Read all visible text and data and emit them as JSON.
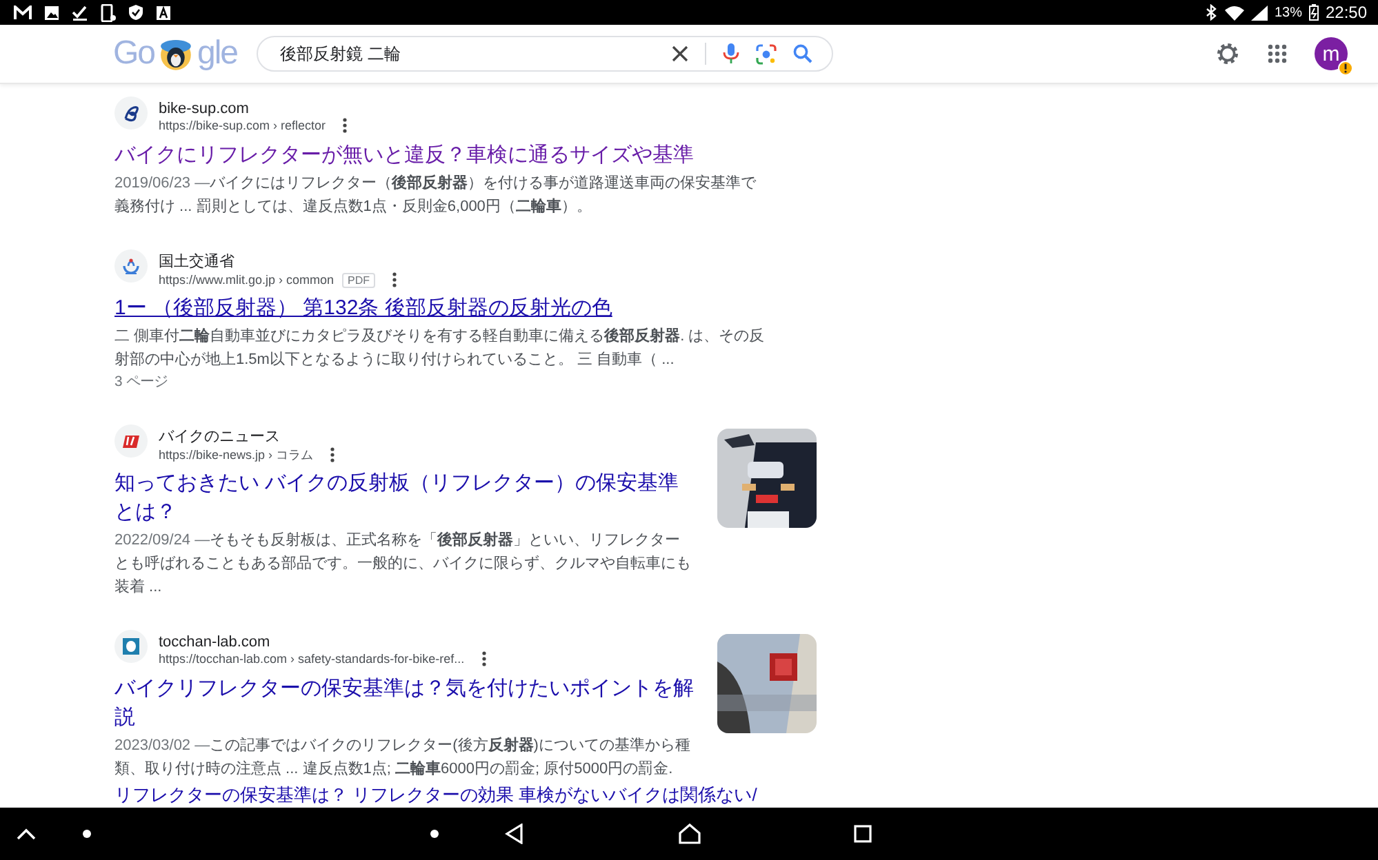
{
  "status_bar": {
    "battery": "13%",
    "time": "22:50"
  },
  "header": {
    "logo": {
      "left": "Go",
      "right": "gle"
    },
    "search": {
      "value": "後部反射鏡 二輪"
    },
    "avatar": "m"
  },
  "results": [
    {
      "site": "bike-sup.com",
      "url": "https://bike-sup.com › reflector",
      "title": "バイクにリフレクターが無いと違反？車検に通るサイズや基準",
      "visited": true,
      "underlined": false,
      "date": "2019/06/23 —",
      "snippet": "バイクにはリフレクター（**後部反射器**）を付ける事が道路運送車両の保安基準で義務付け ... 罰則としては、違反点数1点・反則金6,000円（**二輪車**）。"
    },
    {
      "site": "国土交通省",
      "url": "https://www.mlit.go.jp › common",
      "pdf_label": "PDF",
      "title": "1ー （後部反射器） 第132条 後部反射器の反射光の色",
      "visited": false,
      "underlined": true,
      "snippet": "二 側車付**二輪**自動車並びにカタピラ及びそりを有する軽自動車に備える**後部反射器**. は、その反射部の中心が地上1.5m以下となるように取り付けられていること。 三 自動車（ ...",
      "pages": "3 ページ"
    },
    {
      "site": "バイクのニュース",
      "url": "https://bike-news.jp › コラム",
      "title": "知っておきたい バイクの反射板（リフレクター）の保安基準とは？",
      "visited": false,
      "underlined": false,
      "date": "2022/09/24 —",
      "snippet": "そもそも反射板は、正式名称を「**後部反射器**」といい、リフレクターとも呼ばれることもある部品です。一般的に、バイクに限らず、クルマや自転車にも装着 ..."
    },
    {
      "site": "tocchan-lab.com",
      "url": "https://tocchan-lab.com › safety-standards-for-bike-ref...",
      "title": "バイクリフレクターの保安基準は？気を付けたいポイントを解説",
      "visited": false,
      "underlined": false,
      "date": "2023/03/02 —",
      "snippet": "この記事ではバイクのリフレクター(後方**反射器**)についての基準から種類、取り付け時の注意点 ... 違反点数1点; **二輪車**6000円の罰金; 原付5000円の罰金.",
      "sitelinks": "リフレクターの保安基準は？ リフレクターの効果 車検がないバイクは関係ない/"
    }
  ]
}
